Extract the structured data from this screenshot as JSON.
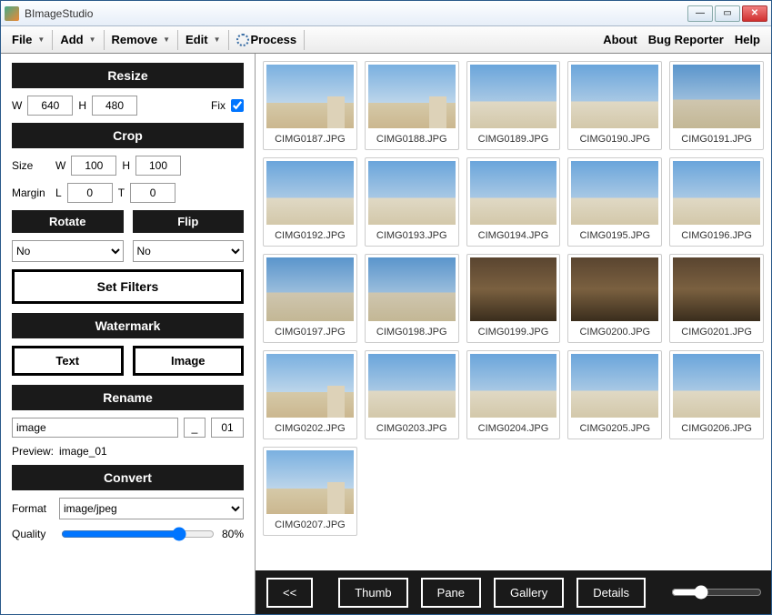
{
  "window": {
    "title": "BImageStudio"
  },
  "menu": {
    "file": "File",
    "add": "Add",
    "remove": "Remove",
    "edit": "Edit",
    "process": "Process",
    "about": "About",
    "bugreporter": "Bug Reporter",
    "help": "Help"
  },
  "resize": {
    "header": "Resize",
    "w_label": "W",
    "w": "640",
    "h_label": "H",
    "h": "480",
    "fix_label": "Fix",
    "fix_checked": true
  },
  "crop": {
    "header": "Crop",
    "size_label": "Size",
    "margin_label": "Margin",
    "w_label": "W",
    "w": "100",
    "h_label": "H",
    "h": "100",
    "l_label": "L",
    "l": "0",
    "t_label": "T",
    "t": "0"
  },
  "rotate": {
    "header": "Rotate",
    "value": "No"
  },
  "flip": {
    "header": "Flip",
    "value": "No"
  },
  "filters": {
    "button": "Set Filters"
  },
  "watermark": {
    "header": "Watermark",
    "text_btn": "Text",
    "image_btn": "Image"
  },
  "rename": {
    "header": "Rename",
    "base": "image",
    "sep": "_",
    "counter": "01",
    "preview_label": "Preview:",
    "preview_value": "image_01"
  },
  "convert": {
    "header": "Convert",
    "format_label": "Format",
    "format": "image/jpeg",
    "quality_label": "Quality",
    "quality_pct": "80%"
  },
  "bottombar": {
    "back": "<<",
    "thumb": "Thumb",
    "pane": "Pane",
    "gallery": "Gallery",
    "details": "Details"
  },
  "thumbnails": [
    {
      "name": "CIMG0187.JPG",
      "cls": "sky1"
    },
    {
      "name": "CIMG0188.JPG",
      "cls": "sky1"
    },
    {
      "name": "CIMG0189.JPG",
      "cls": "sky2"
    },
    {
      "name": "CIMG0190.JPG",
      "cls": "sky2"
    },
    {
      "name": "CIMG0191.JPG",
      "cls": "sky3"
    },
    {
      "name": "CIMG0192.JPG",
      "cls": "sky2"
    },
    {
      "name": "CIMG0193.JPG",
      "cls": "sky2"
    },
    {
      "name": "CIMG0194.JPG",
      "cls": "sky2"
    },
    {
      "name": "CIMG0195.JPG",
      "cls": "sky2"
    },
    {
      "name": "CIMG0196.JPG",
      "cls": "sky2"
    },
    {
      "name": "CIMG0197.JPG",
      "cls": "sky3"
    },
    {
      "name": "CIMG0198.JPG",
      "cls": "sky3"
    },
    {
      "name": "CIMG0199.JPG",
      "cls": "interior"
    },
    {
      "name": "CIMG0200.JPG",
      "cls": "interior"
    },
    {
      "name": "CIMG0201.JPG",
      "cls": "interior"
    },
    {
      "name": "CIMG0202.JPG",
      "cls": "sky1"
    },
    {
      "name": "CIMG0203.JPG",
      "cls": "sky2"
    },
    {
      "name": "CIMG0204.JPG",
      "cls": "sky2"
    },
    {
      "name": "CIMG0205.JPG",
      "cls": "sky2"
    },
    {
      "name": "CIMG0206.JPG",
      "cls": "sky2"
    },
    {
      "name": "CIMG0207.JPG",
      "cls": "sky1"
    }
  ]
}
